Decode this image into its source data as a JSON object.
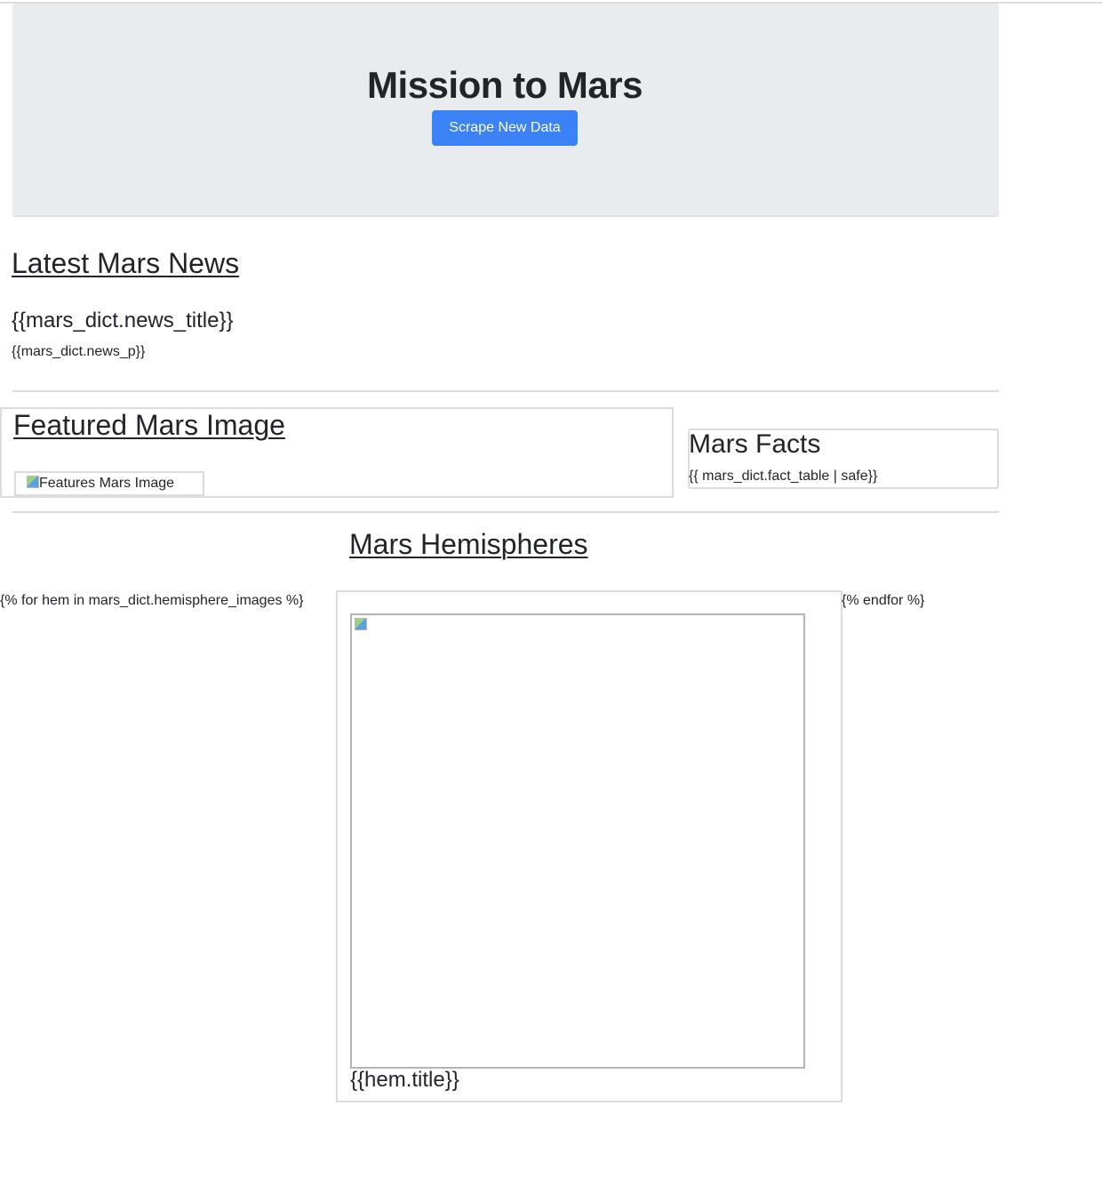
{
  "header": {
    "title": "Mission to Mars",
    "scrape_button_label": "Scrape New Data",
    "accent_color": "#3b82f6",
    "jumbotron_color": "#e9ecef"
  },
  "news": {
    "heading": "Latest Mars News",
    "title": "{{mars_dict.news_title}}",
    "paragraph": "{{mars_dict.news_p}}"
  },
  "featured": {
    "heading": "Featured Mars Image",
    "image_alt": "Features Mars Image",
    "icon": "broken-image-icon"
  },
  "facts": {
    "heading": "Mars Facts",
    "table": "{{ mars_dict.fact_table | safe}}"
  },
  "hemispheres": {
    "heading": "Mars Hemispheres",
    "loop_open": "{% for hem in mars_dict.hemisphere_images %}",
    "loop_close": "{% endfor %}",
    "item_title": "{{hem.title}}",
    "icon": "broken-image-icon"
  }
}
